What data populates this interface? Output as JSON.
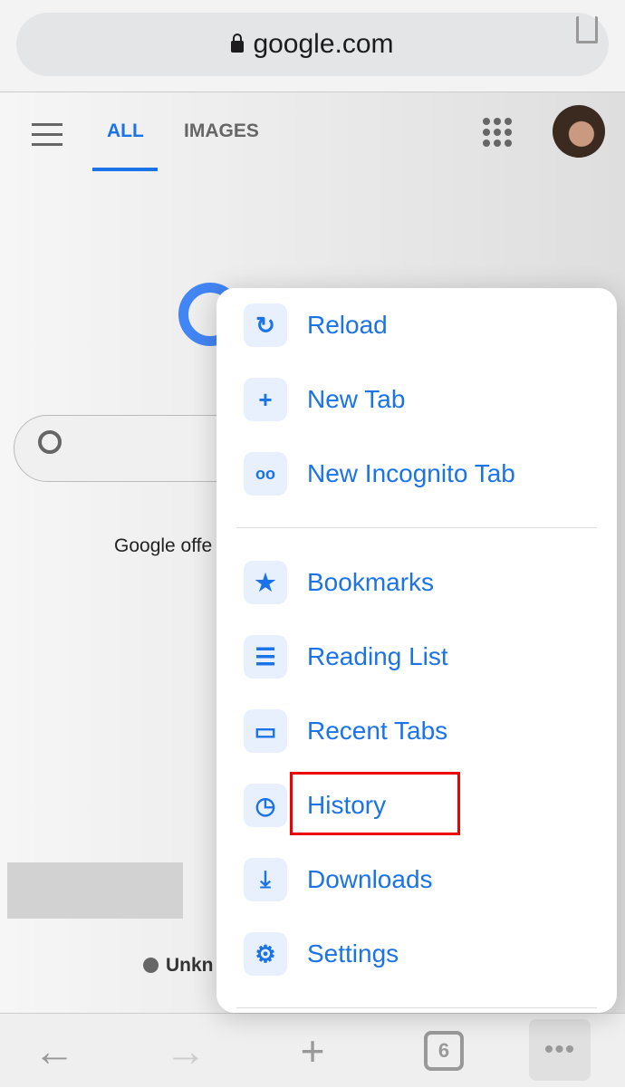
{
  "address_bar": {
    "url": "google.com"
  },
  "google_nav": {
    "tabs": [
      {
        "label": "ALL",
        "active": true
      },
      {
        "label": "IMAGES",
        "active": false
      }
    ]
  },
  "page": {
    "partial_text": "Google offe",
    "location_text": "Unkn"
  },
  "toolbar": {
    "tab_count": "6"
  },
  "menu": {
    "items": [
      {
        "label": "Reload",
        "icon": "reload-icon"
      },
      {
        "label": "New Tab",
        "icon": "plus-icon"
      },
      {
        "label": "New Incognito Tab",
        "icon": "incognito-icon"
      },
      {
        "label": "Bookmarks",
        "icon": "star-icon"
      },
      {
        "label": "Reading List",
        "icon": "list-icon"
      },
      {
        "label": "Recent Tabs",
        "icon": "devices-icon"
      },
      {
        "label": "History",
        "icon": "history-icon",
        "highlighted": true
      },
      {
        "label": "Downloads",
        "icon": "download-icon"
      },
      {
        "label": "Settings",
        "icon": "gear-icon"
      }
    ]
  },
  "colors": {
    "accent": "#1a73e8",
    "highlight": "#e00000"
  }
}
